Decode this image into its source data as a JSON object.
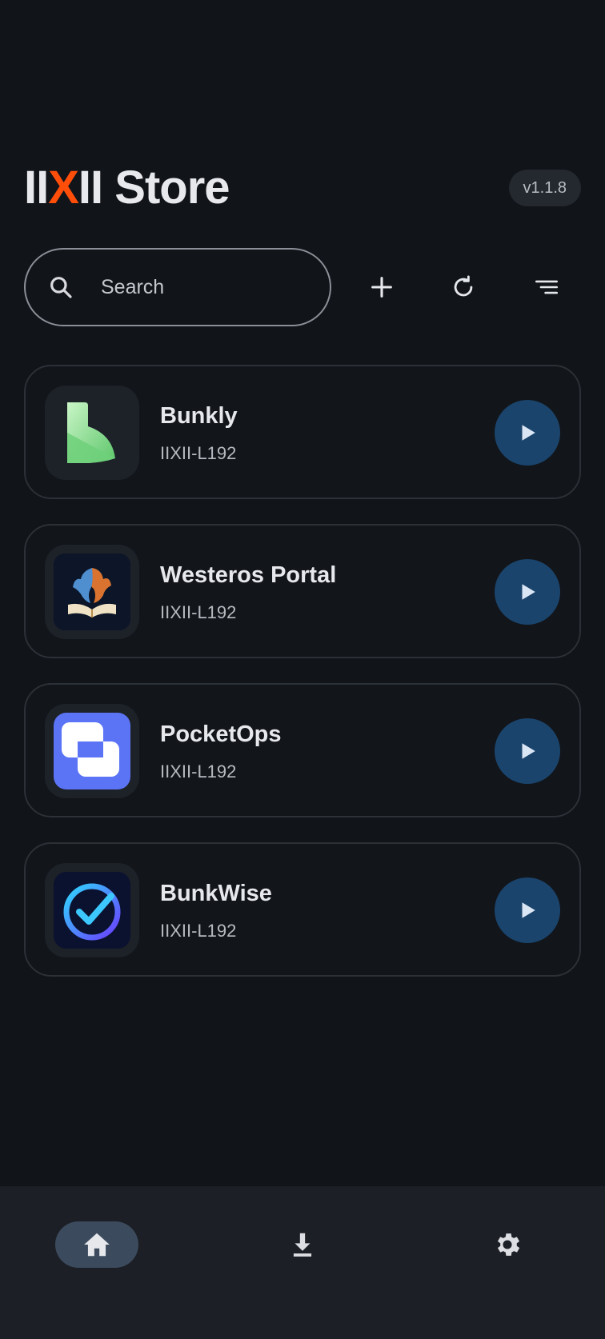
{
  "header": {
    "title_accent_prefix": "II",
    "title_accent": "X",
    "title_rest": "II Store",
    "version": "v1.1.8"
  },
  "search": {
    "placeholder": "Search",
    "icon": "search-icon"
  },
  "toolbar": {
    "add_icon": "plus-icon",
    "refresh_icon": "refresh-icon",
    "sort_icon": "sort-lines-icon"
  },
  "apps": [
    {
      "name": "Bunkly",
      "id": "IIXII-L192",
      "icon": "bunkly-logo-icon"
    },
    {
      "name": "Westeros Portal",
      "id": "IIXII-L192",
      "icon": "westeros-dragon-book-icon"
    },
    {
      "name": "PocketOps",
      "id": "IIXII-L192",
      "icon": "pocketops-squares-icon"
    },
    {
      "name": "BunkWise",
      "id": "IIXII-L192",
      "icon": "bunkwise-check-icon"
    }
  ],
  "bottom_nav": {
    "items": [
      {
        "icon": "home-icon",
        "active": true
      },
      {
        "icon": "download-icon",
        "active": false
      },
      {
        "icon": "gear-icon",
        "active": false
      }
    ]
  },
  "colors": {
    "background": "#111419",
    "accent": "#ff4d0a",
    "play_button": "#1a446c",
    "nav_active": "#3c4a5d"
  }
}
